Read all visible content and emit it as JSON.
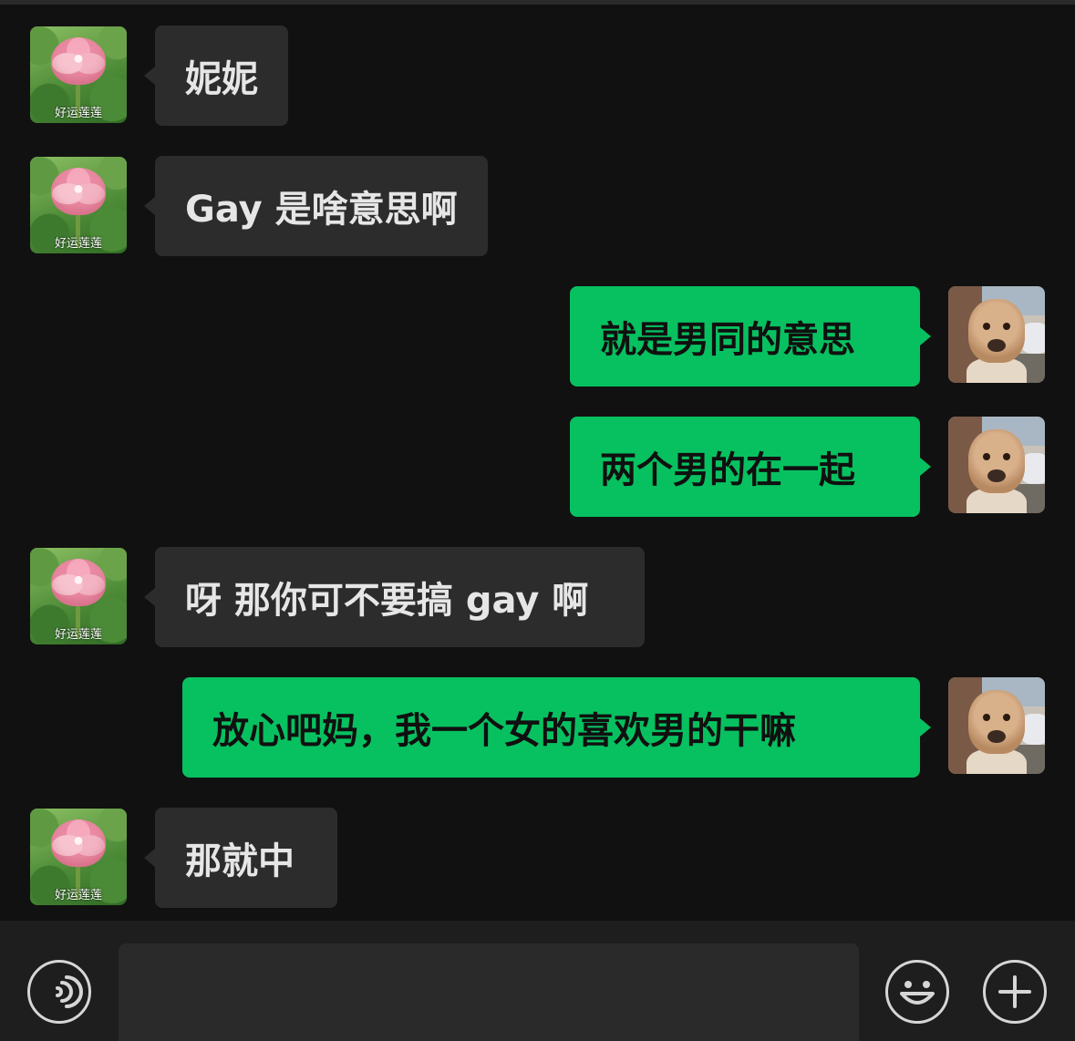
{
  "messages": [
    {
      "side": "in",
      "text": "妮妮",
      "avatar": {
        "icon": "lotus-avatar-icon",
        "caption": "好运莲莲"
      }
    },
    {
      "side": "in",
      "text": "Gay 是啥意思啊",
      "avatar": {
        "icon": "lotus-avatar-icon",
        "caption": "好运莲莲"
      }
    },
    {
      "side": "out",
      "text": "就是男同的意思",
      "avatar": {
        "icon": "dog-avatar-icon"
      }
    },
    {
      "side": "out",
      "text": "两个男的在一起",
      "avatar": {
        "icon": "dog-avatar-icon"
      }
    },
    {
      "side": "in",
      "text": "呀 那你可不要搞 gay 啊",
      "avatar": {
        "icon": "lotus-avatar-icon",
        "caption": "好运莲莲"
      }
    },
    {
      "side": "out",
      "text": "放心吧妈，我一个女的喜欢男的干嘛",
      "avatar": {
        "icon": "dog-avatar-icon"
      }
    },
    {
      "side": "in",
      "text": "那就中",
      "avatar": {
        "icon": "lotus-avatar-icon",
        "caption": "好运莲莲"
      }
    }
  ],
  "composer": {
    "voice_icon": "voice-icon",
    "emoji_icon": "emoji-icon",
    "plus_icon": "plus-icon",
    "input_value": ""
  },
  "colors": {
    "background": "#111111",
    "incoming_bubble": "#2c2c2c",
    "outgoing_bubble": "#07c160"
  }
}
